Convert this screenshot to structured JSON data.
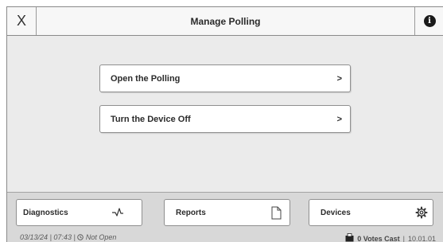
{
  "header": {
    "close_label": "X",
    "title": "Manage Polling",
    "info_label": "i"
  },
  "menu": [
    {
      "label": "Open the Polling",
      "chevron": ">"
    },
    {
      "label": "Turn the Device Off",
      "chevron": ">"
    }
  ],
  "footer": {
    "nav": [
      {
        "label": "Diagnostics",
        "icon": "pulse-icon"
      },
      {
        "label": "Reports",
        "icon": "document-icon"
      },
      {
        "label": "Devices",
        "icon": "gear-icon"
      }
    ]
  },
  "status": {
    "date": "03/13/24",
    "sep1": "|",
    "time": "07:43",
    "sep2": "|",
    "polls_state": "Not Open",
    "votes_cast": "0 Votes Cast",
    "sep3": "|",
    "version": "10.01.01"
  },
  "colors": {
    "screen_background": "#ebebeb",
    "footer_background": "#d8d8d8",
    "button_background": "#ffffff",
    "border": "#8f8f8f"
  }
}
